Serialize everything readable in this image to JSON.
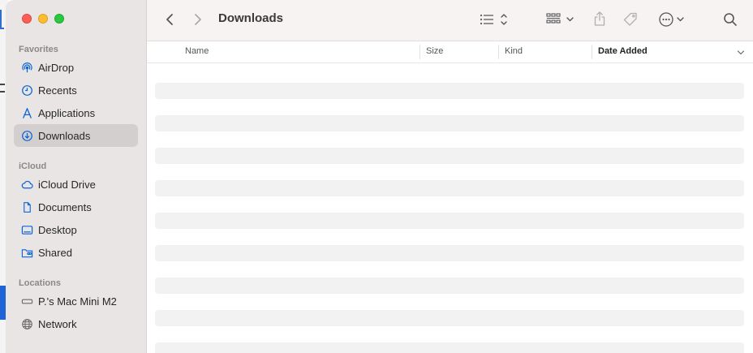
{
  "window": {
    "title": "Downloads"
  },
  "sidebar": {
    "sections": [
      {
        "title": "Favorites",
        "items": [
          {
            "label": "AirDrop",
            "icon": "airdrop-icon"
          },
          {
            "label": "Recents",
            "icon": "clock-icon"
          },
          {
            "label": "Applications",
            "icon": "applications-icon"
          },
          {
            "label": "Downloads",
            "icon": "download-icon",
            "selected": true
          }
        ]
      },
      {
        "title": "iCloud",
        "items": [
          {
            "label": "iCloud Drive",
            "icon": "cloud-icon"
          },
          {
            "label": "Documents",
            "icon": "document-icon"
          },
          {
            "label": "Desktop",
            "icon": "desktop-icon"
          },
          {
            "label": "Shared",
            "icon": "shared-folder-icon"
          }
        ]
      },
      {
        "title": "Locations",
        "items": [
          {
            "label": "P.'s Mac Mini M2",
            "icon": "computer-icon"
          },
          {
            "label": "Network",
            "icon": "globe-icon"
          }
        ]
      }
    ]
  },
  "table": {
    "columns": [
      {
        "label": "Name"
      },
      {
        "label": "Size"
      },
      {
        "label": "Kind"
      },
      {
        "label": "Date Added",
        "sorted": true
      }
    ]
  },
  "colors": {
    "accent": "#0a64d8",
    "sidebar_bg": "#e9e5e5",
    "selected_bg": "#d3cfcf"
  }
}
